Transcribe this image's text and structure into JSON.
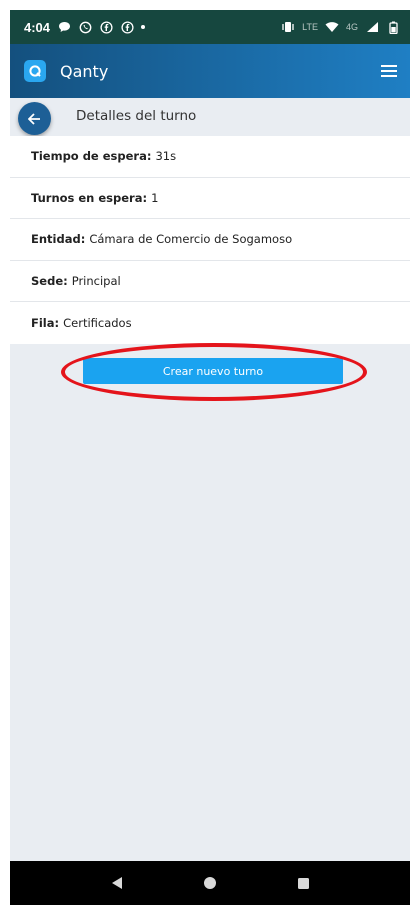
{
  "status_bar": {
    "time": "4:04",
    "network": "4G",
    "volte": "LTE"
  },
  "header": {
    "app_name": "Qanty"
  },
  "page": {
    "title": "Detalles del turno"
  },
  "details": [
    {
      "label": "Tiempo de espera:",
      "value": "31s"
    },
    {
      "label": "Turnos en espera:",
      "value": "1"
    },
    {
      "label": "Entidad:",
      "value": "Cámara de Comercio de Sogamoso"
    },
    {
      "label": "Sede:",
      "value": "Principal"
    },
    {
      "label": "Fila:",
      "value": "Certificados"
    }
  ],
  "actions": {
    "new_turn_label": "Crear nuevo turno"
  },
  "colors": {
    "status_bar": "#16473f",
    "header_start": "#14507e",
    "header_end": "#1f7fc4",
    "button": "#1aa3f0",
    "highlight": "#e4141b",
    "background": "#e9edf2"
  },
  "icons": {
    "menu": "hamburger-menu-icon",
    "back": "arrow-left-icon",
    "nav_back": "triangle-back-icon",
    "nav_home": "circle-home-icon",
    "nav_recent": "square-recents-icon"
  }
}
